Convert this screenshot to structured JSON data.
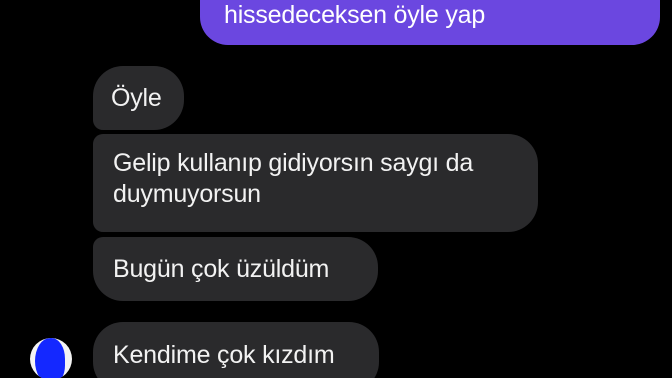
{
  "messages": [
    {
      "direction": "sent",
      "text": "hissedeceksen öyle yap"
    },
    {
      "direction": "received",
      "text": "Öyle"
    },
    {
      "direction": "received",
      "text": "Gelip kullanıp gidiyorsın saygı da duymuyorsun"
    },
    {
      "direction": "received",
      "text": "Bugün çok üzüldüm"
    },
    {
      "direction": "received",
      "text": "Kendime çok kızdım"
    }
  ],
  "colors": {
    "background": "#000000",
    "sent_bubble": "#6b47e0",
    "received_bubble": "#2a2a2c",
    "text": "#f2f2f2",
    "avatar_scribble": "#1428ff"
  },
  "avatar_icon": "avatar-icon"
}
